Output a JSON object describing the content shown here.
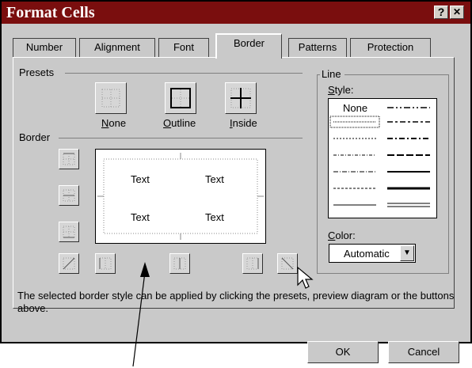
{
  "window": {
    "title": "Format Cells",
    "help_label": "?",
    "close_label": "✕"
  },
  "tabs": [
    {
      "label": "Number"
    },
    {
      "label": "Alignment"
    },
    {
      "label": "Font"
    },
    {
      "label": "Border",
      "active": true
    },
    {
      "label": "Patterns"
    },
    {
      "label": "Protection"
    }
  ],
  "presets": {
    "group_label": "Presets",
    "items": [
      {
        "mnemonic": "N",
        "rest": "one"
      },
      {
        "mnemonic": "O",
        "rest": "utline"
      },
      {
        "mnemonic": "I",
        "rest": "nside"
      }
    ]
  },
  "border": {
    "group_label": "Border",
    "preview_texts": [
      "Text",
      "Text",
      "Text",
      "Text"
    ]
  },
  "line": {
    "group_label": "Line",
    "style_label_mnemonic": "S",
    "style_label_rest": "tyle:",
    "none_label": "None",
    "color_label_mnemonic": "C",
    "color_label_rest": "olor:",
    "color_value": "Automatic"
  },
  "description": "The selected border style can be applied by clicking the presets, preview diagram or the buttons above.",
  "buttons": {
    "ok": "OK",
    "cancel": "Cancel"
  },
  "colors": {
    "title_bar": "#7a0e0e",
    "dialog_bg": "#c9c9c9"
  }
}
